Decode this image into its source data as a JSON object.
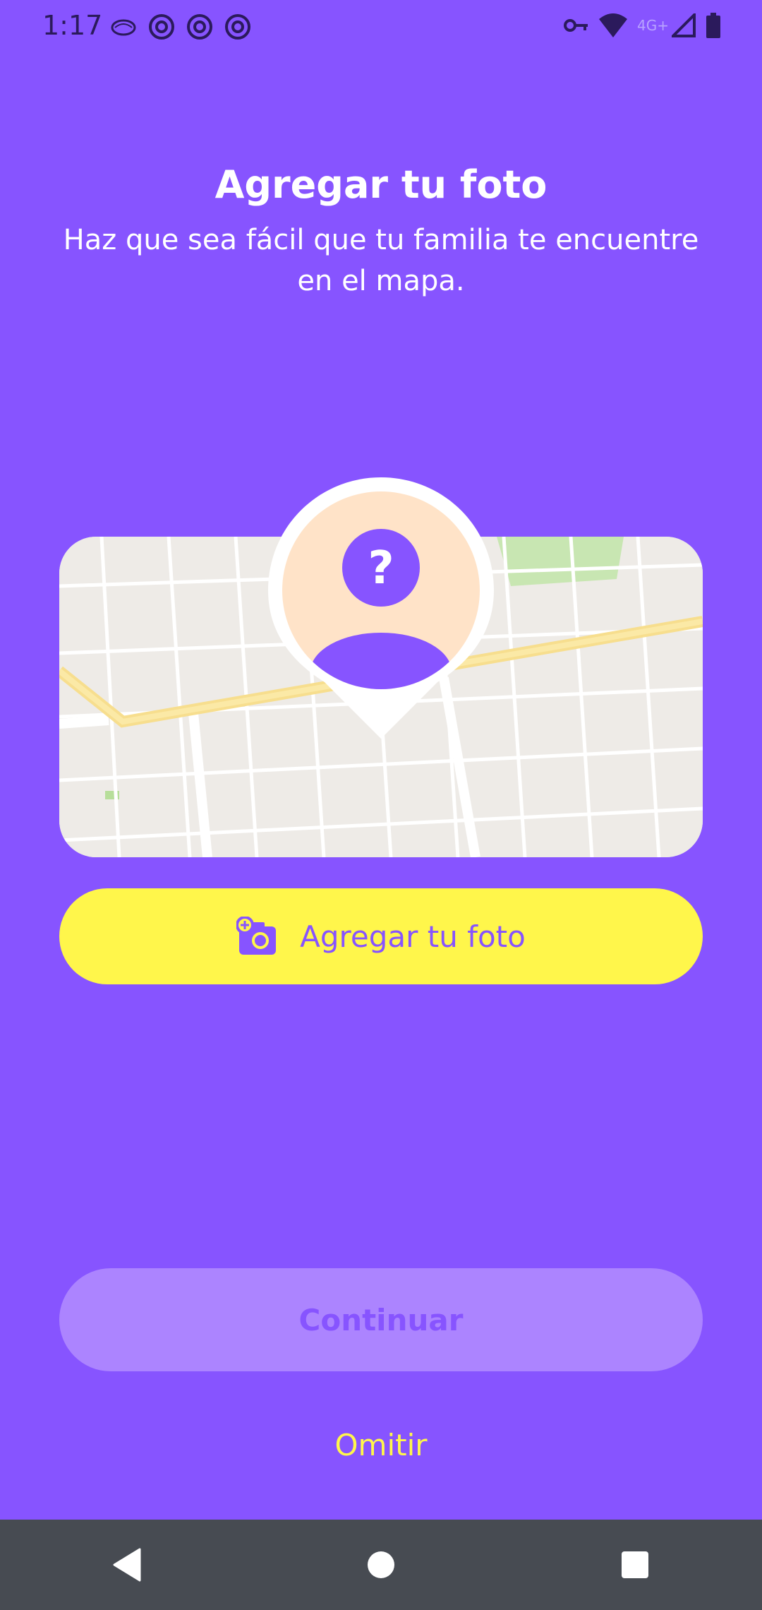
{
  "status_bar": {
    "time": "1:17",
    "network": "4G+",
    "icons": [
      "chameleon-icon",
      "at-icon",
      "at-icon",
      "at-icon",
      "vpn-key-icon",
      "wifi-icon",
      "signal-icon",
      "battery-icon"
    ]
  },
  "header": {
    "title": "Agregar tu foto",
    "subtitle": "Haz que sea fácil que tu familia te encuentre en el mapa."
  },
  "map": {
    "pin_symbol": "?",
    "pin_icon": "person-placeholder-icon"
  },
  "buttons": {
    "add_photo_label": "Agregar tu foto",
    "add_photo_icon": "add-photo-camera-icon",
    "continue_label": "Continuar",
    "skip_label": "Omitir"
  },
  "nav": {
    "icons": [
      "back-icon",
      "home-icon",
      "recents-icon"
    ]
  },
  "colors": {
    "background": "#8754FF",
    "accent_yellow": "#FFF64B",
    "continue_disabled": "#AC84FF",
    "nav_bar": "#474B52"
  }
}
